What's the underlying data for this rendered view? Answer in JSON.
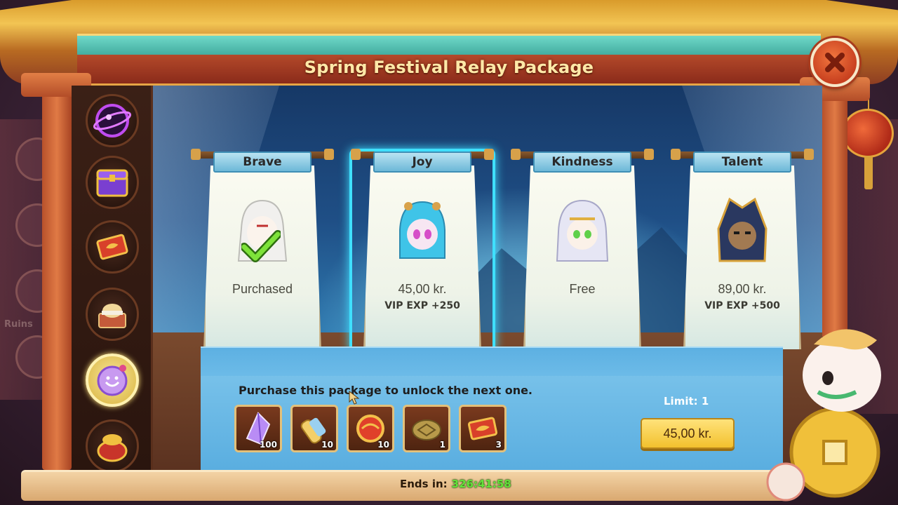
{
  "window": {
    "title": "Spring Festival Relay Package"
  },
  "sidebar": {
    "items": [
      {
        "name": "cosmic-orb",
        "active": false
      },
      {
        "name": "purple-chest",
        "active": false
      },
      {
        "name": "red-ticket",
        "active": false
      },
      {
        "name": "gift-box",
        "active": false
      },
      {
        "name": "lucky-charm",
        "active": true
      },
      {
        "name": "red-pot",
        "active": false
      }
    ]
  },
  "packages": [
    {
      "tab": "Brave",
      "price": "Purchased",
      "vip": "",
      "state": "purchased"
    },
    {
      "tab": "Joy",
      "price": "45,00 kr.",
      "vip": "VIP EXP +250",
      "state": "selected"
    },
    {
      "tab": "Kindness",
      "price": "Free",
      "vip": "",
      "state": "locked"
    },
    {
      "tab": "Talent",
      "price": "89,00 kr.",
      "vip": "VIP EXP +500",
      "state": "locked"
    }
  ],
  "info": {
    "instruction": "Purchase this package to unlock the next one.",
    "limit": "Limit: 1",
    "buy_label": "45,00 kr.",
    "rewards": [
      {
        "icon": "purple-crystal-icon",
        "count": "100"
      },
      {
        "icon": "golden-scroll-icon",
        "count": "10"
      },
      {
        "icon": "red-gold-orb-icon",
        "count": "10"
      },
      {
        "icon": "turtle-shell-icon",
        "count": "1"
      },
      {
        "icon": "red-ticket-icon",
        "count": "3"
      }
    ]
  },
  "footer": {
    "ends_label": "Ends in:",
    "ends_time": "326:41:58"
  },
  "background": {
    "ruins_label": "Ruins"
  },
  "colors": {
    "accent_teal": "#3fe0ff",
    "buy_button": "#f2c12e",
    "timer_green": "#63e23a"
  }
}
